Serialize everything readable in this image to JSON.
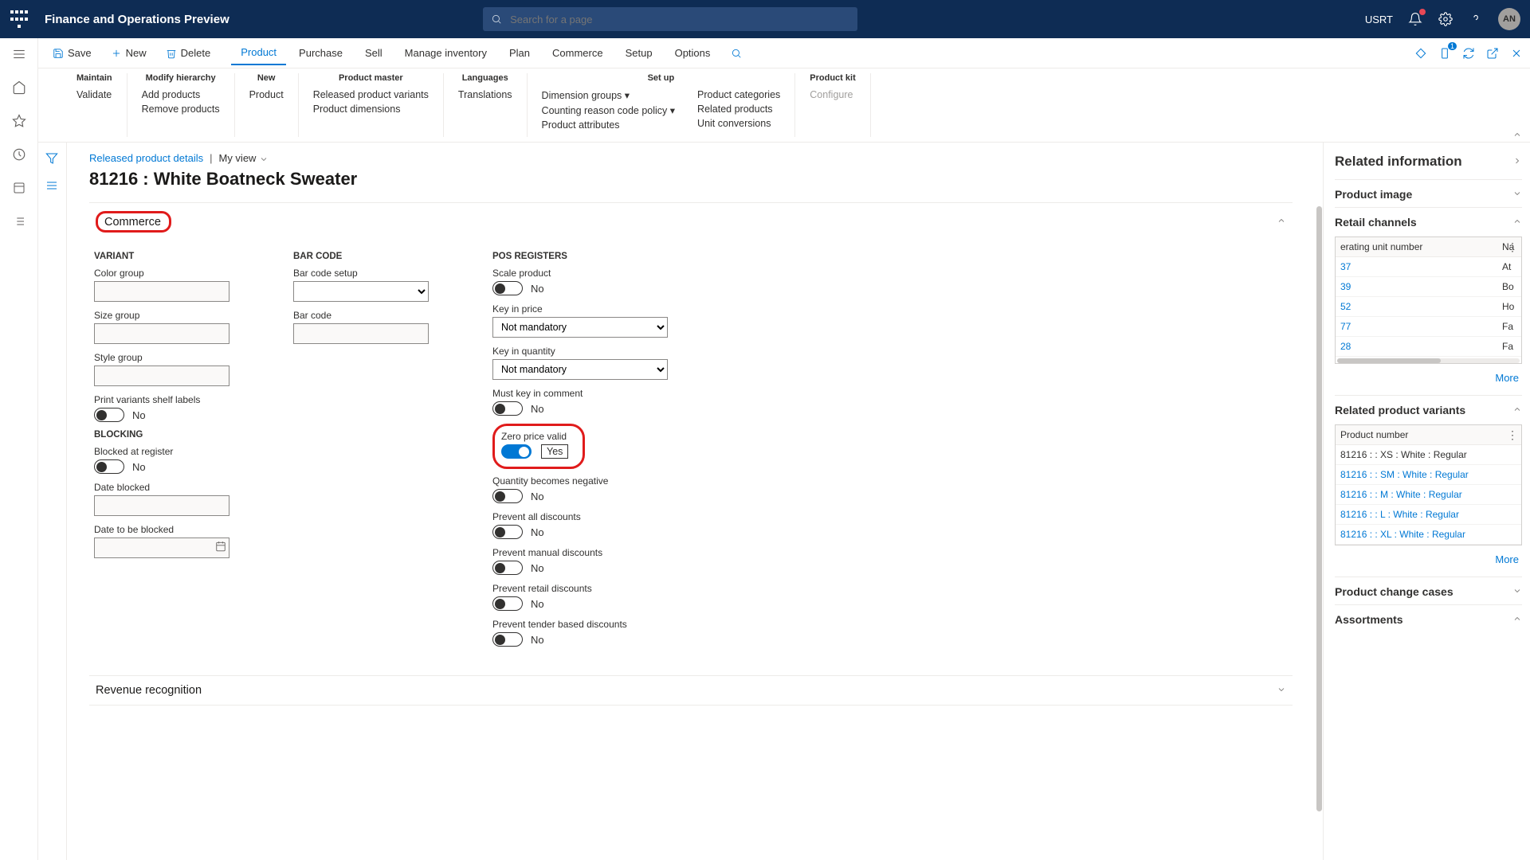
{
  "topbar": {
    "title": "Finance and Operations Preview",
    "search_placeholder": "Search for a page",
    "company": "USRT",
    "avatar": "AN"
  },
  "actionpane": {
    "save": "Save",
    "new": "New",
    "delete": "Delete",
    "tabs": [
      "Product",
      "Purchase",
      "Sell",
      "Manage inventory",
      "Plan",
      "Commerce",
      "Setup",
      "Options"
    ],
    "active_tab": 0,
    "badge": "1"
  },
  "ribbon": {
    "groups": [
      {
        "title": "Maintain",
        "links": [
          [
            "Validate"
          ]
        ]
      },
      {
        "title": "Modify hierarchy",
        "links": [
          [
            "Add products",
            "Remove products"
          ]
        ]
      },
      {
        "title": "New",
        "links": [
          [
            "Product"
          ]
        ]
      },
      {
        "title": "Product master",
        "links": [
          [
            "Released product variants",
            "Product dimensions"
          ]
        ]
      },
      {
        "title": "Languages",
        "links": [
          [
            "Translations"
          ]
        ]
      },
      {
        "title": "Set up",
        "links": [
          [
            "Dimension groups ▾",
            "Counting reason code policy ▾",
            "Product attributes"
          ],
          [
            "Product categories",
            "Related products",
            "Unit conversions"
          ]
        ]
      },
      {
        "title": "Product kit",
        "links": [
          [
            "Configure"
          ]
        ],
        "disabled": true
      }
    ]
  },
  "breadcrumb": {
    "link": "Released product details",
    "sep": "|",
    "view": "My view"
  },
  "page_title": "81216 : White Boatneck Sweater",
  "fasttab_commerce": {
    "title": "Commerce",
    "variant_h": "VARIANT",
    "color_group": "Color group",
    "size_group": "Size group",
    "style_group": "Style group",
    "print_variants": "Print variants shelf labels",
    "print_variants_val": "No",
    "blocking_h": "BLOCKING",
    "blocked_reg": "Blocked at register",
    "blocked_reg_val": "No",
    "date_blocked": "Date blocked",
    "date_tobe": "Date to be blocked",
    "barcode_h": "BAR CODE",
    "barcode_setup": "Bar code setup",
    "barcode": "Bar code",
    "pos_h": "POS REGISTERS",
    "scale_product": "Scale product",
    "scale_product_val": "No",
    "key_price": "Key in price",
    "key_price_val": "Not mandatory",
    "key_qty": "Key in quantity",
    "key_qty_val": "Not mandatory",
    "must_key": "Must key in comment",
    "must_key_val": "No",
    "zero_price": "Zero price valid",
    "zero_price_val": "Yes",
    "qty_neg": "Quantity becomes negative",
    "qty_neg_val": "No",
    "prev_all": "Prevent all discounts",
    "prev_all_val": "No",
    "prev_man": "Prevent manual discounts",
    "prev_man_val": "No",
    "prev_ret": "Prevent retail discounts",
    "prev_ret_val": "No",
    "prev_tender": "Prevent tender based discounts",
    "prev_tender_val": "No"
  },
  "fasttab_revenue": {
    "title": "Revenue recognition"
  },
  "rightpanel": {
    "title": "Related information",
    "product_image": "Product image",
    "retail_channels": "Retail channels",
    "rc_col1": "erating unit number",
    "rc_col2": "Na",
    "rc_rows": [
      [
        "37",
        "At"
      ],
      [
        "39",
        "Bo"
      ],
      [
        "52",
        "Ho"
      ],
      [
        "77",
        "Fa"
      ],
      [
        "28",
        "Fa"
      ]
    ],
    "more": "More",
    "related_variants": "Related product variants",
    "rv_col": "Product number",
    "rv_rows": [
      "81216 :  : XS : White : Regular",
      "81216 :  : SM : White : Regular",
      "81216 :  : M : White : Regular",
      "81216 :  : L : White : Regular",
      "81216 :  : XL : White : Regular"
    ],
    "product_change": "Product change cases",
    "assortments": "Assortments"
  }
}
